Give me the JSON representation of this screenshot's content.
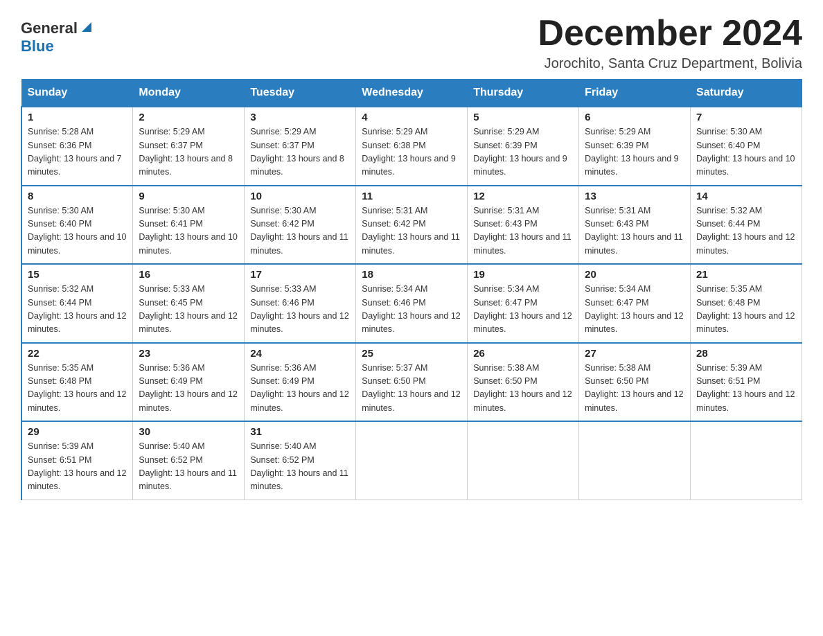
{
  "logo": {
    "general": "General",
    "blue": "Blue"
  },
  "title": "December 2024",
  "location": "Jorochito, Santa Cruz Department, Bolivia",
  "headers": [
    "Sunday",
    "Monday",
    "Tuesday",
    "Wednesday",
    "Thursday",
    "Friday",
    "Saturday"
  ],
  "weeks": [
    [
      {
        "day": "1",
        "sunrise": "5:28 AM",
        "sunset": "6:36 PM",
        "daylight": "13 hours and 7 minutes."
      },
      {
        "day": "2",
        "sunrise": "5:29 AM",
        "sunset": "6:37 PM",
        "daylight": "13 hours and 8 minutes."
      },
      {
        "day": "3",
        "sunrise": "5:29 AM",
        "sunset": "6:37 PM",
        "daylight": "13 hours and 8 minutes."
      },
      {
        "day": "4",
        "sunrise": "5:29 AM",
        "sunset": "6:38 PM",
        "daylight": "13 hours and 9 minutes."
      },
      {
        "day": "5",
        "sunrise": "5:29 AM",
        "sunset": "6:39 PM",
        "daylight": "13 hours and 9 minutes."
      },
      {
        "day": "6",
        "sunrise": "5:29 AM",
        "sunset": "6:39 PM",
        "daylight": "13 hours and 9 minutes."
      },
      {
        "day": "7",
        "sunrise": "5:30 AM",
        "sunset": "6:40 PM",
        "daylight": "13 hours and 10 minutes."
      }
    ],
    [
      {
        "day": "8",
        "sunrise": "5:30 AM",
        "sunset": "6:40 PM",
        "daylight": "13 hours and 10 minutes."
      },
      {
        "day": "9",
        "sunrise": "5:30 AM",
        "sunset": "6:41 PM",
        "daylight": "13 hours and 10 minutes."
      },
      {
        "day": "10",
        "sunrise": "5:30 AM",
        "sunset": "6:42 PM",
        "daylight": "13 hours and 11 minutes."
      },
      {
        "day": "11",
        "sunrise": "5:31 AM",
        "sunset": "6:42 PM",
        "daylight": "13 hours and 11 minutes."
      },
      {
        "day": "12",
        "sunrise": "5:31 AM",
        "sunset": "6:43 PM",
        "daylight": "13 hours and 11 minutes."
      },
      {
        "day": "13",
        "sunrise": "5:31 AM",
        "sunset": "6:43 PM",
        "daylight": "13 hours and 11 minutes."
      },
      {
        "day": "14",
        "sunrise": "5:32 AM",
        "sunset": "6:44 PM",
        "daylight": "13 hours and 12 minutes."
      }
    ],
    [
      {
        "day": "15",
        "sunrise": "5:32 AM",
        "sunset": "6:44 PM",
        "daylight": "13 hours and 12 minutes."
      },
      {
        "day": "16",
        "sunrise": "5:33 AM",
        "sunset": "6:45 PM",
        "daylight": "13 hours and 12 minutes."
      },
      {
        "day": "17",
        "sunrise": "5:33 AM",
        "sunset": "6:46 PM",
        "daylight": "13 hours and 12 minutes."
      },
      {
        "day": "18",
        "sunrise": "5:34 AM",
        "sunset": "6:46 PM",
        "daylight": "13 hours and 12 minutes."
      },
      {
        "day": "19",
        "sunrise": "5:34 AM",
        "sunset": "6:47 PM",
        "daylight": "13 hours and 12 minutes."
      },
      {
        "day": "20",
        "sunrise": "5:34 AM",
        "sunset": "6:47 PM",
        "daylight": "13 hours and 12 minutes."
      },
      {
        "day": "21",
        "sunrise": "5:35 AM",
        "sunset": "6:48 PM",
        "daylight": "13 hours and 12 minutes."
      }
    ],
    [
      {
        "day": "22",
        "sunrise": "5:35 AM",
        "sunset": "6:48 PM",
        "daylight": "13 hours and 12 minutes."
      },
      {
        "day": "23",
        "sunrise": "5:36 AM",
        "sunset": "6:49 PM",
        "daylight": "13 hours and 12 minutes."
      },
      {
        "day": "24",
        "sunrise": "5:36 AM",
        "sunset": "6:49 PM",
        "daylight": "13 hours and 12 minutes."
      },
      {
        "day": "25",
        "sunrise": "5:37 AM",
        "sunset": "6:50 PM",
        "daylight": "13 hours and 12 minutes."
      },
      {
        "day": "26",
        "sunrise": "5:38 AM",
        "sunset": "6:50 PM",
        "daylight": "13 hours and 12 minutes."
      },
      {
        "day": "27",
        "sunrise": "5:38 AM",
        "sunset": "6:50 PM",
        "daylight": "13 hours and 12 minutes."
      },
      {
        "day": "28",
        "sunrise": "5:39 AM",
        "sunset": "6:51 PM",
        "daylight": "13 hours and 12 minutes."
      }
    ],
    [
      {
        "day": "29",
        "sunrise": "5:39 AM",
        "sunset": "6:51 PM",
        "daylight": "13 hours and 12 minutes."
      },
      {
        "day": "30",
        "sunrise": "5:40 AM",
        "sunset": "6:52 PM",
        "daylight": "13 hours and 11 minutes."
      },
      {
        "day": "31",
        "sunrise": "5:40 AM",
        "sunset": "6:52 PM",
        "daylight": "13 hours and 11 minutes."
      },
      null,
      null,
      null,
      null
    ]
  ]
}
